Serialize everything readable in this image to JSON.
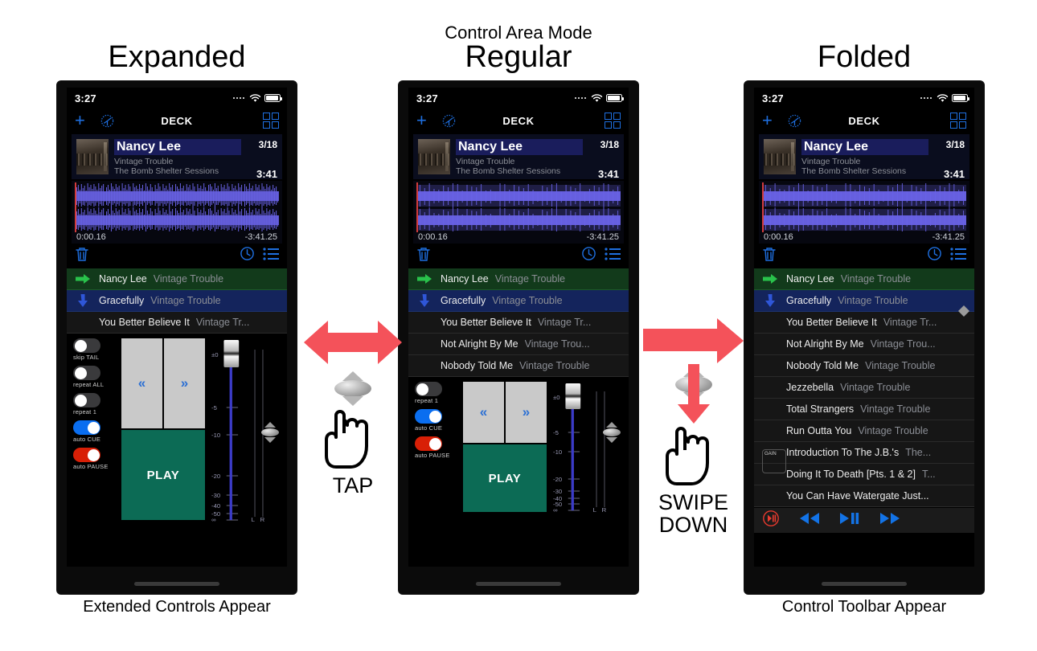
{
  "headings": {
    "mode_label": "Control Area Mode",
    "left": "Expanded",
    "middle": "Regular",
    "right": "Folded"
  },
  "footnotes": {
    "left": "Extended Controls Appear",
    "right": "Control Toolbar Appear"
  },
  "gestures": {
    "tap": {
      "label": "TAP",
      "arrow": "double-arrow-left-right"
    },
    "swipe": {
      "label_line1": "SWIPE",
      "label_line2": "DOWN",
      "arrow": "arrow-right"
    }
  },
  "colors": {
    "accent_blue": "#1e6fe0",
    "play_green": "#0c6b55",
    "current_row": "#123a1b",
    "next_row": "#14245c",
    "red_arrow": "#f4525a",
    "toggle_on": "#0a6ef0",
    "toggle_red": "#d81f06",
    "waveform": "#6a63e8"
  },
  "statusbar": {
    "time": "3:27",
    "icons": [
      "signal-dots-icon",
      "wifi-icon",
      "battery-icon"
    ]
  },
  "navbar": {
    "title": "DECK",
    "add_label": "+",
    "icons": [
      "plus-icon",
      "compass-icon",
      "grid-icon"
    ]
  },
  "track_header": {
    "title": "Nancy Lee",
    "artist": "Vintage Trouble",
    "album": "The Bomb Shelter Sessions",
    "position": "3/18",
    "duration": "3:41"
  },
  "waveform": {
    "elapsed": "0:00.16",
    "remaining": "-3:41.25"
  },
  "icon_row": {
    "icons": [
      "trash-icon",
      "clock-icon",
      "list-icon"
    ]
  },
  "playlist": {
    "rows": [
      {
        "mark": "play-arrow-icon",
        "title": "Nancy Lee",
        "artist": "Vintage Trouble",
        "state": "current"
      },
      {
        "mark": "down-arrow-icon",
        "title": "Gracefully",
        "artist": "Vintage Trouble",
        "state": "next"
      },
      {
        "mark": "",
        "title": "You Better Believe It",
        "artist": "Vintage Tr...",
        "state": "normal"
      },
      {
        "mark": "",
        "title": "Not Alright By Me",
        "artist": "Vintage Trou...",
        "state": "normal"
      },
      {
        "mark": "",
        "title": "Nobody Told Me",
        "artist": "Vintage Trouble",
        "state": "normal"
      },
      {
        "mark": "",
        "title": "Jezzebella",
        "artist": "Vintage Trouble",
        "state": "normal"
      },
      {
        "mark": "",
        "title": "Total Strangers",
        "artist": "Vintage Trouble",
        "state": "normal"
      },
      {
        "mark": "",
        "title": "Run Outta You",
        "artist": "Vintage Trouble",
        "state": "normal"
      },
      {
        "mark": "",
        "title": "Introduction To The J.B.'s",
        "artist": "The...",
        "state": "normal"
      },
      {
        "mark": "",
        "title": "Doing It To Death [Pts. 1 & 2]",
        "artist": "T...",
        "state": "normal"
      },
      {
        "mark": "",
        "title": "You Can Have Watergate Just...",
        "artist": "",
        "state": "normal"
      }
    ]
  },
  "controls": {
    "toggles_expanded": [
      {
        "label": "skip TAIL",
        "state": "off"
      },
      {
        "label": "repeat ALL",
        "state": "off"
      },
      {
        "label": "repeat 1",
        "state": "off"
      },
      {
        "label": "auto CUE",
        "state": "on"
      },
      {
        "label": "auto PAUSE",
        "state": "red"
      }
    ],
    "toggles_regular": [
      {
        "label": "repeat 1",
        "state": "off"
      },
      {
        "label": "auto CUE",
        "state": "on"
      },
      {
        "label": "auto PAUSE",
        "state": "red"
      }
    ],
    "cue_prev": "«",
    "cue_next": "»",
    "play_label": "PLAY",
    "meter": {
      "scale_labels": [
        "±0",
        "-5",
        "-10",
        "-20",
        "-30",
        "-40",
        "-50",
        "∞"
      ],
      "channels": [
        "L",
        "R"
      ]
    }
  },
  "toolbar": {
    "buttons": [
      "cue-play-pause-icon",
      "rewind-icon",
      "play-pause-icon",
      "fast-forward-icon"
    ],
    "gain_label": "GAIN"
  }
}
